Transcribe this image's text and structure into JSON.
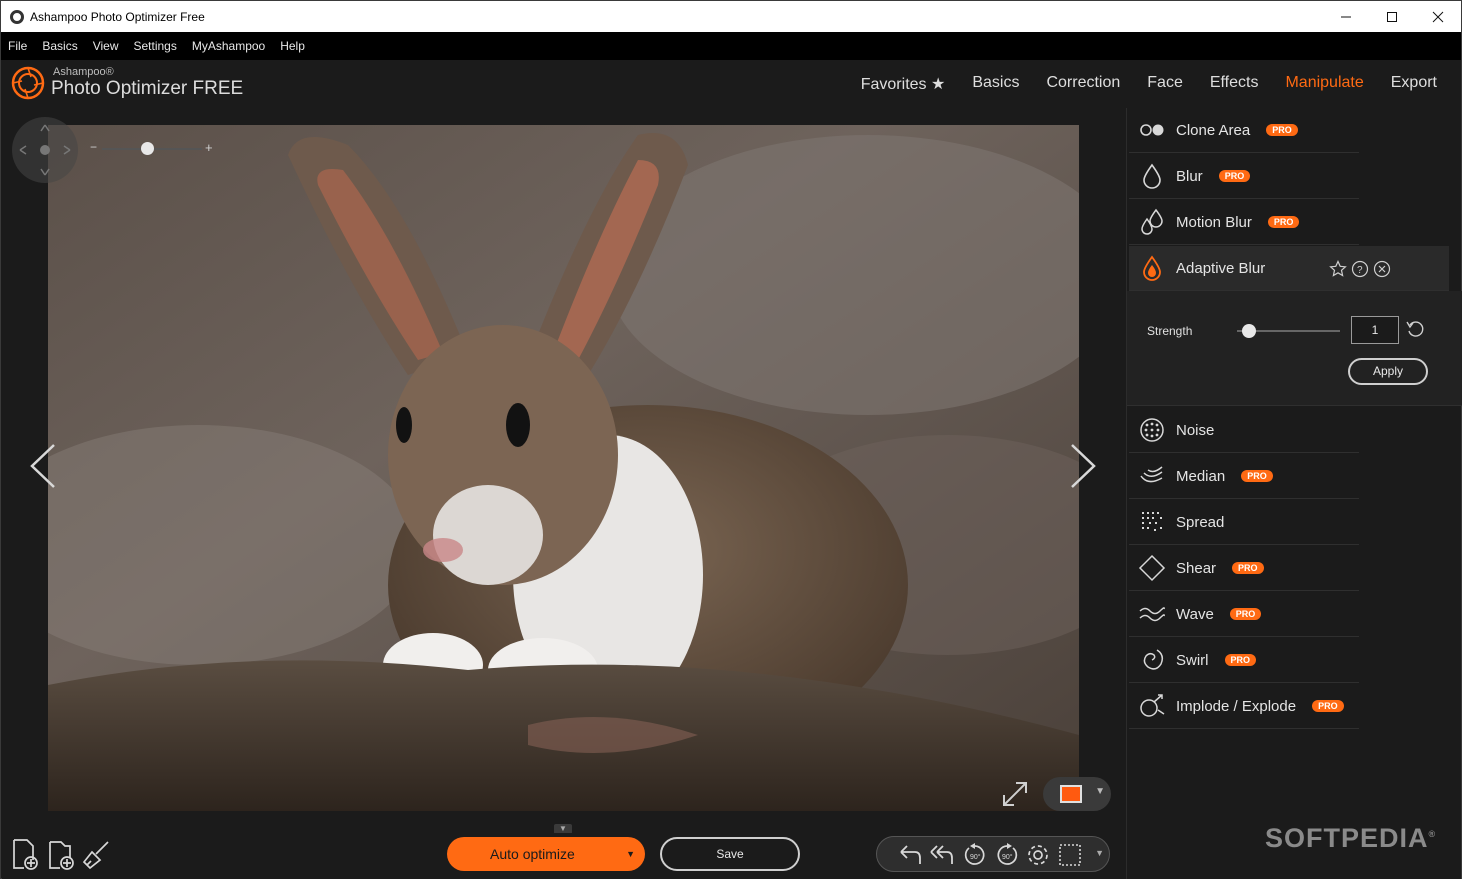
{
  "window": {
    "title": "Ashampoo Photo Optimizer Free",
    "min": "—",
    "max": "☐",
    "close": "✕"
  },
  "menu": [
    "File",
    "Basics",
    "View",
    "Settings",
    "MyAshampoo",
    "Help"
  ],
  "brand": {
    "small": "Ashampoo®",
    "big": "Photo Optimizer FREE"
  },
  "tabs": [
    {
      "label": "Favorites ★",
      "active": false
    },
    {
      "label": "Basics",
      "active": false
    },
    {
      "label": "Correction",
      "active": false
    },
    {
      "label": "Face",
      "active": false
    },
    {
      "label": "Effects",
      "active": false
    },
    {
      "label": "Manipulate",
      "active": true
    },
    {
      "label": "Export",
      "active": false
    }
  ],
  "zoom": {
    "minus": "−",
    "plus": "+",
    "level": 0.45
  },
  "tools_top": [
    {
      "label": "Clone Area",
      "pro": "PRO",
      "icon": "clone-icon"
    },
    {
      "label": "Blur",
      "pro": "PRO",
      "icon": "drop-icon"
    },
    {
      "label": "Motion Blur",
      "pro": "PRO",
      "icon": "motion-drops-icon"
    },
    {
      "label": "Adaptive Blur",
      "pro": "",
      "icon": "adaptive-drop-icon",
      "active": true
    }
  ],
  "adaptive_blur": {
    "strength_label": "Strength",
    "strength_value": "1",
    "strength_fraction": 0.12,
    "apply_label": "Apply"
  },
  "tools_bottom": [
    {
      "label": "Noise",
      "pro": "",
      "icon": "noise-icon"
    },
    {
      "label": "Median",
      "pro": "PRO",
      "icon": "median-icon"
    },
    {
      "label": "Spread",
      "pro": "",
      "icon": "spread-icon"
    },
    {
      "label": "Shear",
      "pro": "PRO",
      "icon": "shear-icon"
    },
    {
      "label": "Wave",
      "pro": "PRO",
      "icon": "wave-icon"
    },
    {
      "label": "Swirl",
      "pro": "PRO",
      "icon": "swirl-icon"
    },
    {
      "label": "Implode / Explode",
      "pro": "PRO",
      "icon": "implode-icon"
    }
  ],
  "bottom": {
    "auto_optimize": "Auto optimize",
    "save": "Save"
  },
  "watermark": {
    "text": "SOFTPEDIA",
    "mark": "®"
  },
  "colors": {
    "accent": "#ff6a13",
    "background": "#1b1b1b",
    "panel_active": "#2a2a2a"
  }
}
